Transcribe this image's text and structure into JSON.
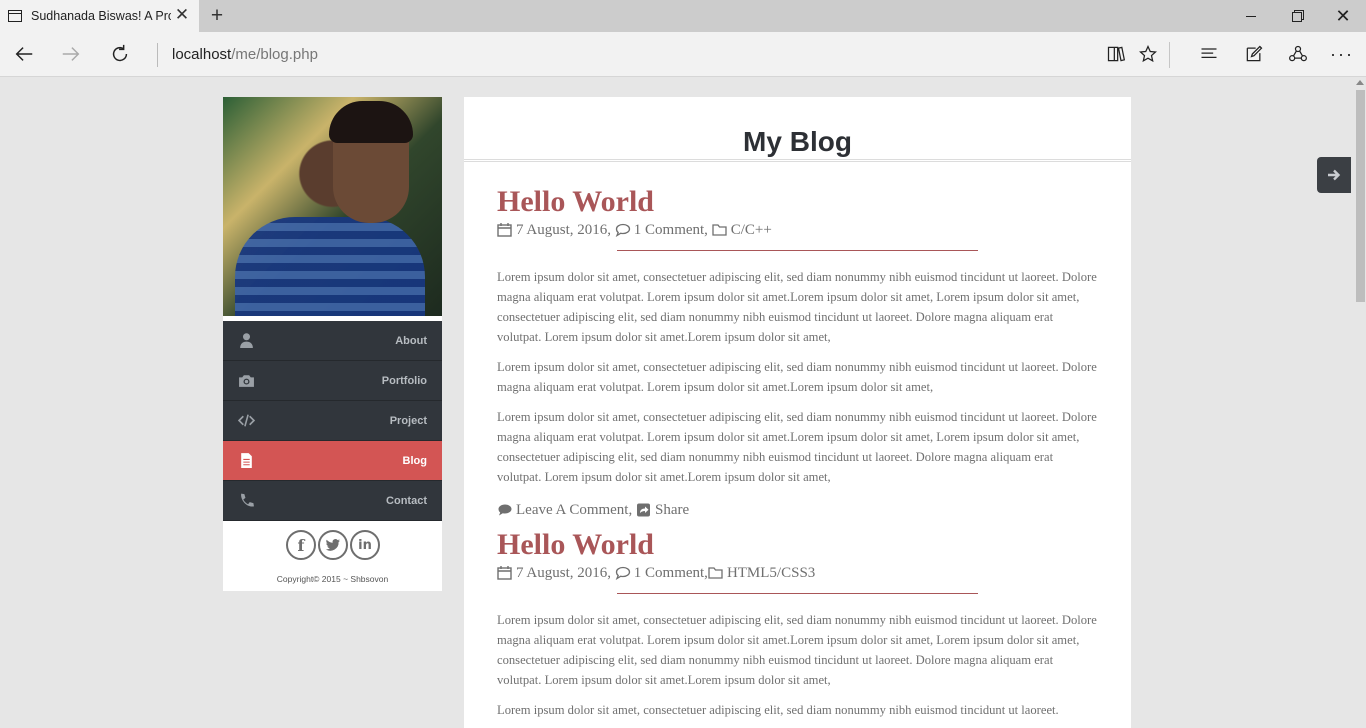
{
  "browser": {
    "tab_title": "Sudhanada Biswas! A Pro",
    "address_host": "localhost",
    "address_path": "/me/blog.php"
  },
  "sidebar": {
    "menu": [
      {
        "label": "About",
        "icon": "user-icon"
      },
      {
        "label": "Portfolio",
        "icon": "camera-icon"
      },
      {
        "label": "Project",
        "icon": "code-icon"
      },
      {
        "label": "Blog",
        "icon": "document-icon",
        "active": true
      },
      {
        "label": "Contact",
        "icon": "phone-icon"
      }
    ],
    "social": {
      "facebook": "f",
      "twitter": "twitter-icon",
      "linkedin": "in"
    },
    "copyright": "Copyright© 2015 ~ Shbsovon"
  },
  "blog": {
    "heading": "My Blog",
    "posts": [
      {
        "title": "Hello World",
        "date": "7 August, 2016,",
        "comments": "1 Comment,",
        "category": "C/C++",
        "paragraphs": [
          "Lorem ipsum dolor sit amet, consectetuer adipiscing elit, sed diam nonummy nibh euismod tincidunt ut laoreet. Dolore magna aliquam erat volutpat. Lorem ipsum dolor sit amet.Lorem ipsum dolor sit amet, Lorem ipsum dolor sit amet, consectetuer adipiscing elit, sed diam nonummy nibh euismod tincidunt ut laoreet. Dolore magna aliquam erat volutpat. Lorem ipsum dolor sit amet.Lorem ipsum dolor sit amet,",
          "Lorem ipsum dolor sit amet, consectetuer adipiscing elit, sed diam nonummy nibh euismod tincidunt ut laoreet. Dolore magna aliquam erat volutpat. Lorem ipsum dolor sit amet.Lorem ipsum dolor sit amet,",
          "Lorem ipsum dolor sit amet, consectetuer adipiscing elit, sed diam nonummy nibh euismod tincidunt ut laoreet. Dolore magna aliquam erat volutpat. Lorem ipsum dolor sit amet.Lorem ipsum dolor sit amet, Lorem ipsum dolor sit amet, consectetuer adipiscing elit, sed diam nonummy nibh euismod tincidunt ut laoreet. Dolore magna aliquam erat volutpat. Lorem ipsum dolor sit amet.Lorem ipsum dolor sit amet,"
        ],
        "leave_comment": "Leave A Comment,",
        "share": "Share"
      },
      {
        "title": "Hello World",
        "date": "7 August, 2016,",
        "comments": "1 Comment,",
        "category": "HTML5/CSS3",
        "paragraphs": [
          "Lorem ipsum dolor sit amet, consectetuer adipiscing elit, sed diam nonummy nibh euismod tincidunt ut laoreet. Dolore magna aliquam erat volutpat. Lorem ipsum dolor sit amet.Lorem ipsum dolor sit amet, Lorem ipsum dolor sit amet, consectetuer adipiscing elit, sed diam nonummy nibh euismod tincidunt ut laoreet. Dolore magna aliquam erat volutpat. Lorem ipsum dolor sit amet.Lorem ipsum dolor sit amet,",
          "Lorem ipsum dolor sit amet, consectetuer adipiscing elit, sed diam nonummy nibh euismod tincidunt ut laoreet."
        ]
      }
    ]
  },
  "colors": {
    "accent": "#d35554",
    "title": "#a95658",
    "menu_bg": "#31363c"
  }
}
